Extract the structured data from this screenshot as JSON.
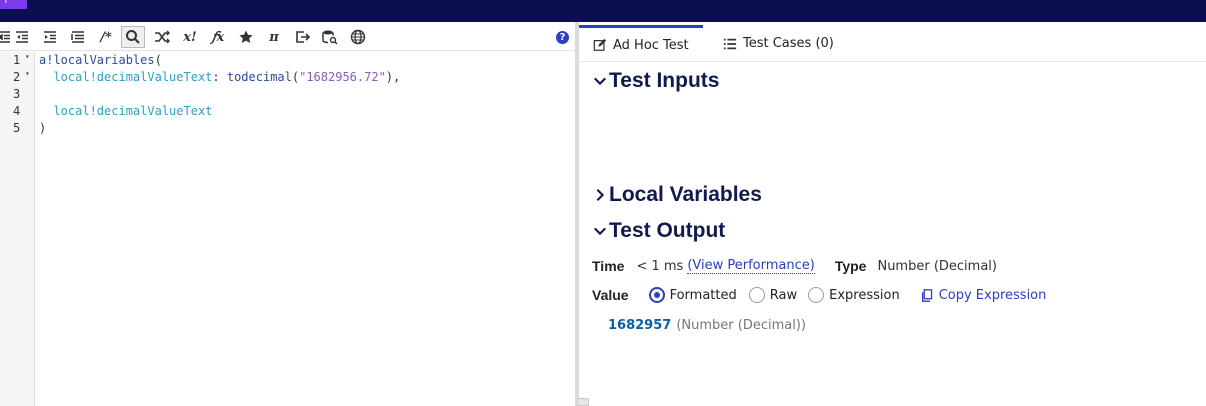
{
  "toolbar": {
    "comment_label": "/*",
    "help_label": "?"
  },
  "editor": {
    "line_numbers": [
      "1",
      "2",
      "3",
      "4",
      "5"
    ],
    "fold_marker": "▾",
    "lines": [
      [
        {
          "t": "a!localVariables",
          "c": "fn"
        },
        {
          "t": "(",
          "c": "pun"
        }
      ],
      [
        {
          "t": "  local!decimalValueText",
          "c": "var"
        },
        {
          "t": ": ",
          "c": "pun"
        },
        {
          "t": "todecimal",
          "c": "fn"
        },
        {
          "t": "(",
          "c": "pun"
        },
        {
          "t": "\"1682956.72\"",
          "c": "str"
        },
        {
          "t": "),",
          "c": "pun"
        }
      ],
      [],
      [
        {
          "t": "  local!decimalValueText",
          "c": "var"
        }
      ],
      [
        {
          "t": ")",
          "c": "pun"
        }
      ]
    ]
  },
  "tabs": {
    "adhoc": "Ad Hoc Test",
    "testcases": "Test Cases (0)"
  },
  "sections": {
    "inputs": "Test Inputs",
    "locals": "Local Variables",
    "output": "Test Output"
  },
  "output": {
    "time_label": "Time",
    "time_value": "< 1 ms",
    "view_perf": "(View Performance)",
    "type_label": "Type",
    "type_value": "Number (Decimal)",
    "value_label": "Value",
    "radio_formatted": "Formatted",
    "radio_raw": "Raw",
    "radio_expression": "Expression",
    "copy_expression": "Copy Expression",
    "result_value": "1682957",
    "result_type": "(Number (Decimal))"
  },
  "colors": {
    "topbar": "#0b0e4f",
    "accent": "#2b3fbf",
    "heading": "#111a4d"
  }
}
